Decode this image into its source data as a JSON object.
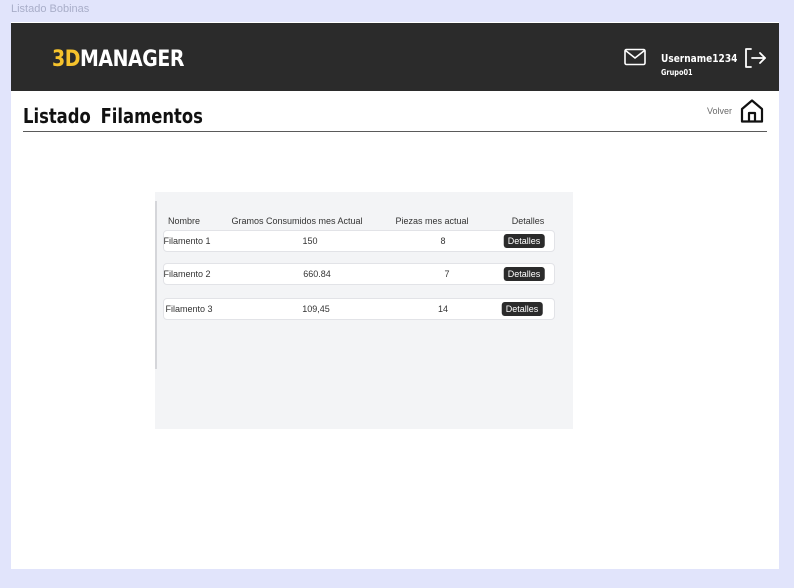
{
  "frame_label": "Listado Bobinas",
  "header": {
    "logo_accent": "3D",
    "logo_rest": "MANAGER",
    "username": "Username1234",
    "group": "Grupo01"
  },
  "page": {
    "title_word1": "Listado",
    "title_word2": "Filamentos",
    "back_label": "Volver"
  },
  "table": {
    "headers": [
      "Nombre",
      "Gramos Consumidos mes Actual",
      "Piezas mes actual",
      "Detalles"
    ],
    "rows": [
      {
        "nombre": "Filamento 1",
        "gramos": "150",
        "piezas": "8",
        "action": "Detalles"
      },
      {
        "nombre": "Filamento 2",
        "gramos": "660.84",
        "piezas": "7",
        "action": "Detalles"
      },
      {
        "nombre": "Filamento 3",
        "gramos": "109,45",
        "piezas": "14",
        "action": "Detalles"
      }
    ]
  },
  "colors": {
    "topbar": "#2b2b2b",
    "accent": "#f6c32c",
    "background": "#e1e4fb",
    "panel": "#f3f4f6"
  }
}
